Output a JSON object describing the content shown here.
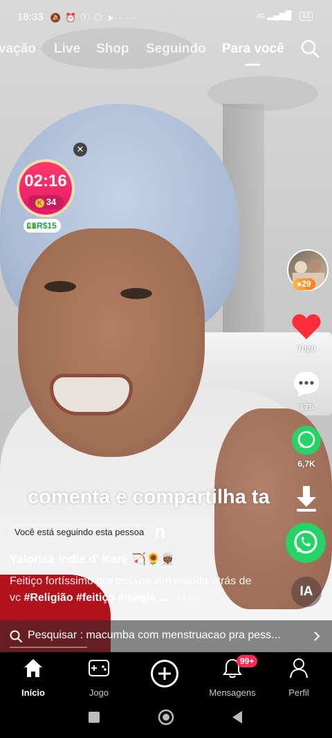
{
  "status_bar": {
    "time": "18:33",
    "notification_icons": [
      "mute-icon",
      "alarm-icon",
      "facebook-icon",
      "instagram-icon",
      "telegram-icon",
      "more-icon"
    ],
    "network": "4G",
    "battery": "83"
  },
  "top_tabs": [
    {
      "label": "vação"
    },
    {
      "label": "Live"
    },
    {
      "label": "Shop"
    },
    {
      "label": "Seguindo"
    },
    {
      "label": "Para você",
      "active": true
    }
  ],
  "reward_timer": {
    "time": "02:16",
    "coins": "34",
    "reward": "R$15"
  },
  "right_rail": {
    "live_viewers": "29",
    "likes": "7020",
    "comments": "175",
    "shares": "6,7K",
    "ai_label": "IA"
  },
  "video_overlay": {
    "line1": "comenta e compartilha ta",
    "line2": "om"
  },
  "toast": "Você está seguindo esta pessoa",
  "post": {
    "author": "Yalorisá índia d' Karê 🏹🌻👳🏾",
    "description": "Feitiço fortíssimo pra pessoa vim manda atrás de vc",
    "hashtags": "#Religião #feitiço #magia ...",
    "more_label": "Mais"
  },
  "search_suggestion": {
    "text": "Pesquisar : macumba com menstruacao pra pess..."
  },
  "bottom_nav": [
    {
      "label": "Início",
      "active": true
    },
    {
      "label": "Jogo"
    },
    {
      "label": ""
    },
    {
      "label": "Mensagens",
      "badge": "99+"
    },
    {
      "label": "Perfil"
    }
  ],
  "colors": {
    "accent": "#fe2c55",
    "timer_pink": "#e8176c",
    "whatsapp_green": "#25d366",
    "like_red": "#ff2d3a"
  }
}
